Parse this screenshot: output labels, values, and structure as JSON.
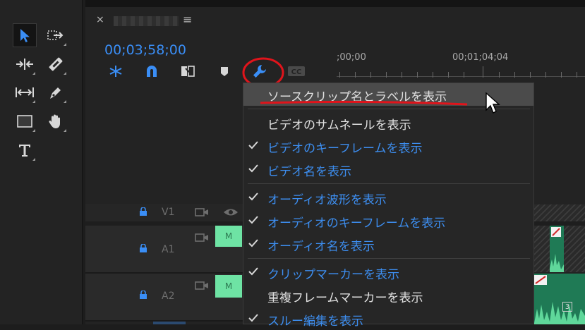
{
  "tools": {
    "items": [
      "selection-tool",
      "track-select-forward-tool",
      "ripple-edit-tool",
      "razor-tool",
      "slip-tool",
      "pen-tool",
      "rectangle-tool",
      "hand-tool",
      "type-tool"
    ]
  },
  "sequence": {
    "close_glyph": "×",
    "menu_glyph": "≡",
    "timecode": "00;03;58;00"
  },
  "ruler": {
    "label_start": ";00;00",
    "label_mid": "00;01;04;04"
  },
  "tracks": {
    "v1": "V1",
    "a1": "A1",
    "a2": "A2",
    "clip_label": "M",
    "clip_count": "3"
  },
  "menu": {
    "items": [
      {
        "label": "ソースクリップ名とラベルを表示",
        "checked": false,
        "highlighted": true
      },
      {
        "label": "ビデオのサムネールを表示",
        "checked": false
      },
      {
        "label": "ビデオのキーフレームを表示",
        "checked": true
      },
      {
        "label": "ビデオ名を表示",
        "checked": true
      },
      {
        "label": "オーディオ波形を表示",
        "checked": true
      },
      {
        "label": "オーディオのキーフレームを表示",
        "checked": true
      },
      {
        "label": "オーディオ名を表示",
        "checked": true
      },
      {
        "label": "クリップマーカーを表示",
        "checked": true
      },
      {
        "label": "重複フレームマーカーを表示",
        "checked": false
      },
      {
        "label": "スルー編集を表示",
        "checked": true
      }
    ]
  },
  "colors": {
    "accent": "#3a8ef6",
    "annotation": "#e0141b",
    "clip_green": "#6ee3a4"
  }
}
